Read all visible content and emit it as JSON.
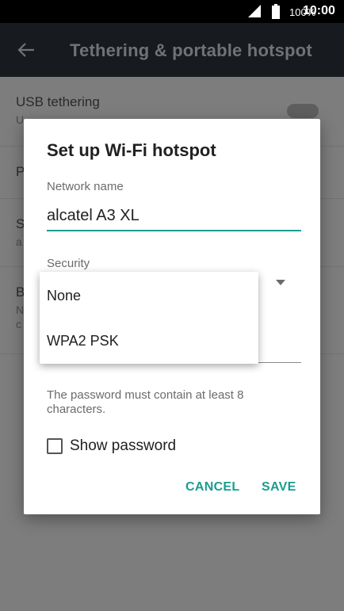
{
  "status_bar": {
    "battery": "100%",
    "time": "10:00"
  },
  "app_bar": {
    "title": "Tethering & portable hotspot"
  },
  "background_list": {
    "usb_tethering": {
      "title": "USB tethering",
      "subtitle": "U"
    },
    "row2": {
      "title": "P"
    },
    "row3": {
      "title": "S",
      "subtitle": "a"
    },
    "row4": {
      "title": "B",
      "subtitle_line1": "N",
      "subtitle_line2": "c"
    }
  },
  "dialog": {
    "title": "Set up Wi-Fi hotspot",
    "network_name_label": "Network name",
    "network_name_value": "alcatel A3 XL",
    "security_label": "Security",
    "hint": "The password must contain at least 8 characters.",
    "show_password_label": "Show password",
    "cancel_label": "CANCEL",
    "save_label": "SAVE"
  },
  "security_menu": {
    "options": [
      "None",
      "WPA2 PSK"
    ]
  },
  "colors": {
    "accent": "#1a9d8f",
    "app_bar": "#171a1e",
    "scrim_bg": "#7d7d7d"
  }
}
